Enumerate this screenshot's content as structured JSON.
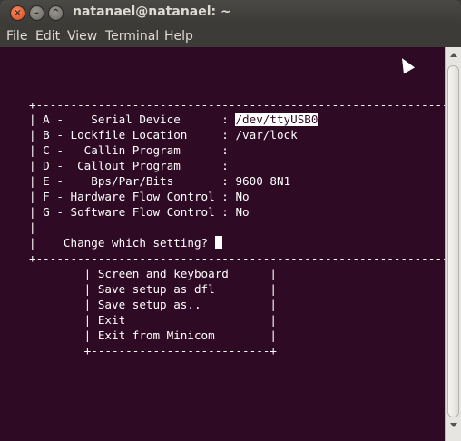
{
  "window": {
    "title": "natanael@natanael: ~",
    "close_glyph": "×",
    "min_glyph": "–",
    "max_glyph": "^"
  },
  "menu": {
    "items": [
      "File",
      "Edit",
      "View",
      "Terminal",
      "Help"
    ]
  },
  "terminal": {
    "top_border": "+-----------------------------------------------------------------",
    "settings": [
      {
        "text": "| A -    Serial Device      : ",
        "value": "/dev/ttyUSB0"
      },
      {
        "text": "| B - Lockfile Location     : /var/lock",
        "value": ""
      },
      {
        "text": "| C -   Callin Program      :",
        "value": ""
      },
      {
        "text": "| D -  Callout Program      :",
        "value": ""
      },
      {
        "text": "| E -    Bps/Par/Bits       : 9600 8N1",
        "value": ""
      },
      {
        "text": "| F - Hardware Flow Control : No",
        "value": ""
      },
      {
        "text": "| G - Software Flow Control : No",
        "value": ""
      }
    ],
    "blank_line": "|",
    "prompt": "|    Change which setting? ",
    "bottom_border": "+-----------------------------------------------------------------",
    "menu_items": [
      "        | Screen and keyboard      |",
      "        | Save setup as dfl        |",
      "        | Save setup as..          |",
      "        | Exit                     |",
      "        | Exit from Minicom        |"
    ],
    "menu_bottom": "        +--------------------------+"
  },
  "colors": {
    "terminal_bg": "#2f0a24",
    "terminal_fg": "#ffffff",
    "titlebar": "#3c3b37",
    "close_button": "#e0541f"
  }
}
